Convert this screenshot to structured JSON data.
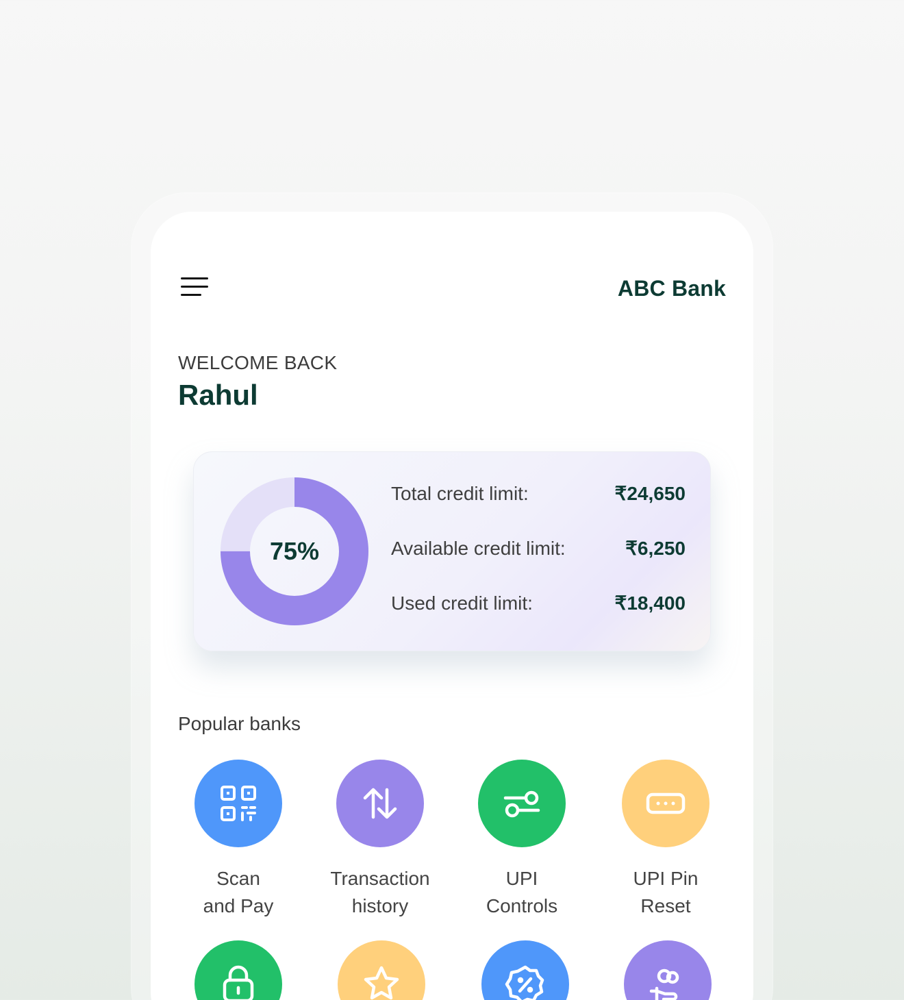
{
  "header": {
    "bank_name": "ABC Bank"
  },
  "greeting": {
    "welcome": "WELCOME BACK",
    "name": "Rahul"
  },
  "credit": {
    "percent_label": "75%",
    "used_fraction": 0.75,
    "rows": [
      {
        "label": "Total credit limit:",
        "value": "₹24,650"
      },
      {
        "label": "Available credit limit:",
        "value": "₹6,250"
      },
      {
        "label": "Used credit limit:",
        "value": "₹18,400"
      }
    ],
    "colors": {
      "used": "#9886ea",
      "remaining": "#e4e0f8"
    }
  },
  "section": {
    "title": "Popular banks"
  },
  "actions": [
    {
      "line1": "Scan",
      "line2": "and Pay",
      "icon": "qr-code-icon",
      "color": "#4f97fa"
    },
    {
      "line1": "Transaction",
      "line2": "history",
      "icon": "arrows-up-down-icon",
      "color": "#9886ea"
    },
    {
      "line1": "UPI",
      "line2": "Controls",
      "icon": "toggle-controls-icon",
      "color": "#22c069"
    },
    {
      "line1": "UPI Pin",
      "line2": "Reset",
      "icon": "pin-dots-icon",
      "color": "#ffd07c"
    },
    {
      "icon": "lock-icon",
      "color": "#22c069"
    },
    {
      "icon": "star-icon",
      "color": "#ffd07c"
    },
    {
      "icon": "discount-badge-icon",
      "color": "#4f97fa"
    },
    {
      "icon": "hand-coins-icon",
      "color": "#9886ea"
    }
  ]
}
